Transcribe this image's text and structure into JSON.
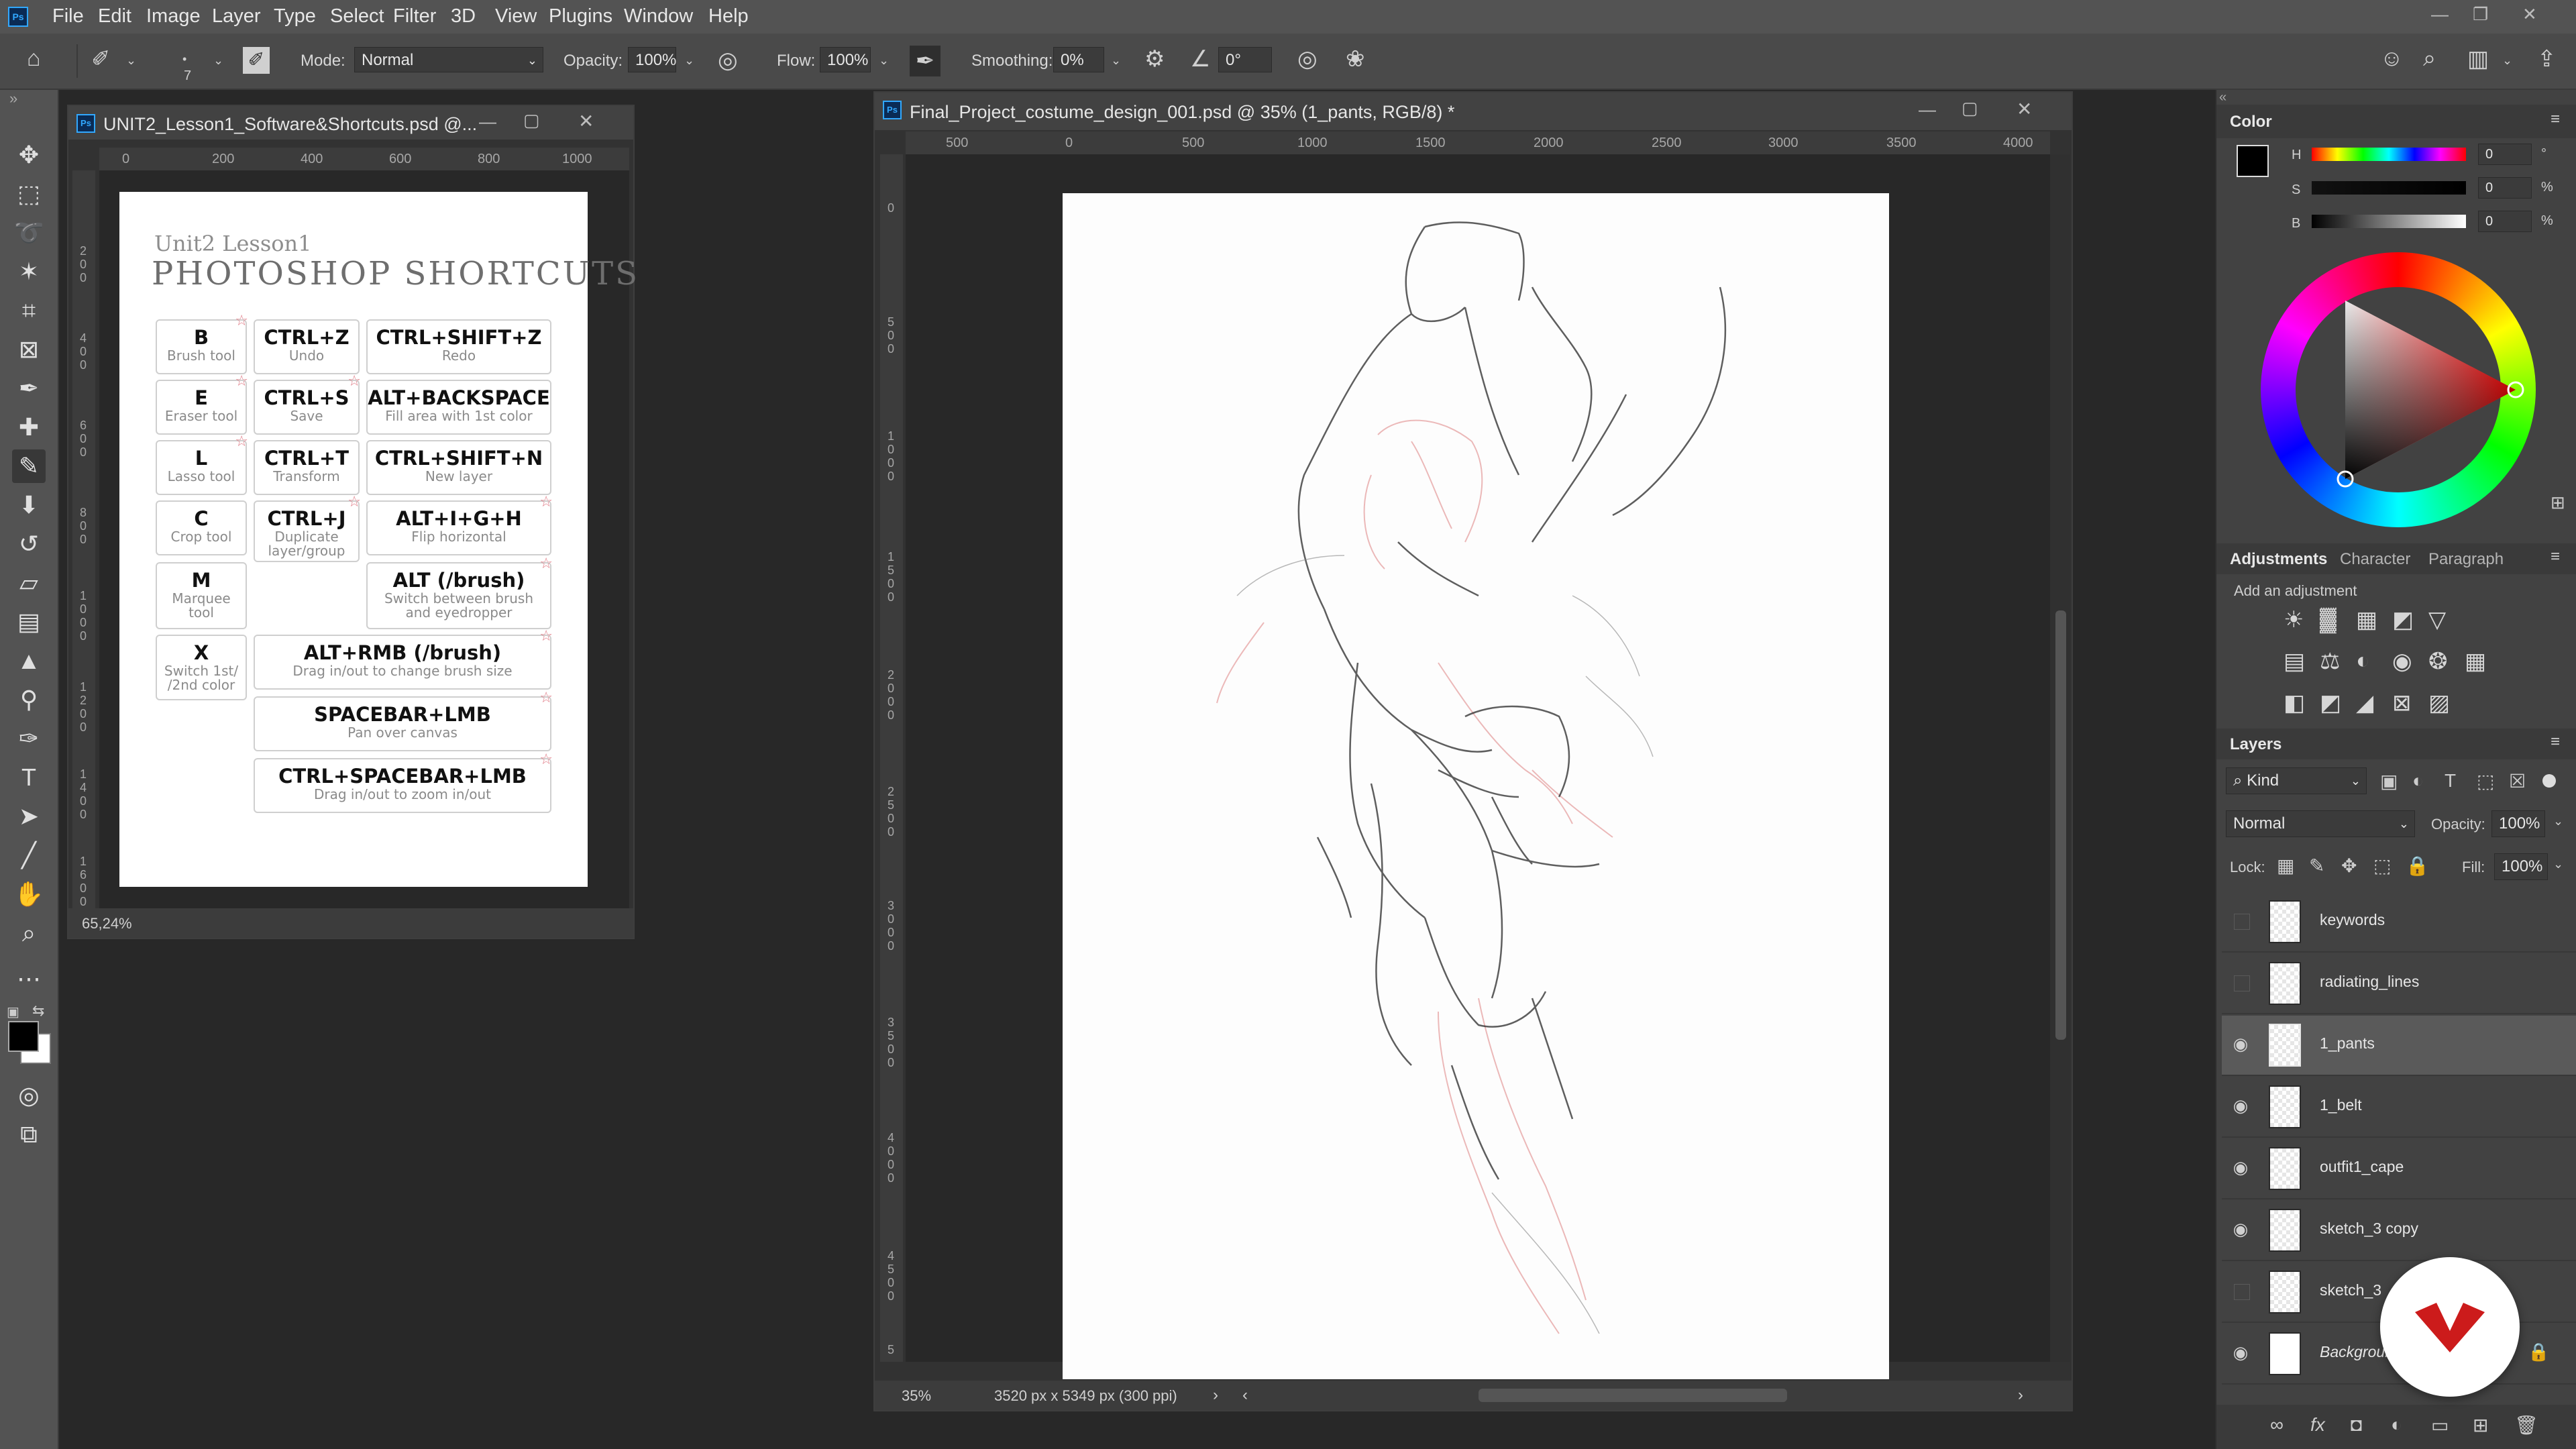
{
  "colors": {
    "accent": "#31a8ff",
    "red_key": "#d42a3a",
    "brand_red": "#cc1b1b"
  },
  "app": {
    "logo_text": "Ps"
  },
  "menu": [
    "File",
    "Edit",
    "Image",
    "Layer",
    "Type",
    "Select",
    "Filter",
    "3D",
    "View",
    "Plugins",
    "Window",
    "Help"
  ],
  "options": {
    "brush_size": "7",
    "mode_label": "Mode:",
    "mode_value": "Normal",
    "opacity_label": "Opacity:",
    "opacity_value": "100%",
    "flow_label": "Flow:",
    "flow_value": "100%",
    "smoothing_label": "Smoothing:",
    "smoothing_value": "0%",
    "angle_value": "0°"
  },
  "doc1": {
    "title": "UNIT2_Lesson1_Software&Shortcuts.psd @...",
    "zoom": "65,24%",
    "ruler_h": [
      "0",
      "200",
      "400",
      "600",
      "800",
      "1000"
    ],
    "ruler_v": [
      "2\n0\n0",
      "4\n0\n0",
      "6\n0\n0",
      "8\n0\n0",
      "1\n0\n0\n0",
      "1\n2\n0\n0",
      "1\n4\n0\n0",
      "1\n6\n0\n0"
    ],
    "heading_small": "Unit2 Lesson1",
    "heading_big": "PHOTOSHOP SHORTCUTS",
    "shortcuts": {
      "b": {
        "key": "B",
        "desc": "Brush tool"
      },
      "ctrl_z": {
        "key": "CTRL+Z",
        "desc": "Undo"
      },
      "ctrl_shift_z": {
        "key": "CTRL+SHIFT+Z",
        "desc": "Redo"
      },
      "e": {
        "key": "E",
        "desc": "Eraser tool"
      },
      "ctrl_s": {
        "key": "CTRL+S",
        "desc": "Save"
      },
      "alt_backspace": {
        "key": "ALT+BACKSPACE",
        "desc": "Fill area with 1st color"
      },
      "l": {
        "key": "L",
        "desc": "Lasso tool"
      },
      "ctrl_t": {
        "key": "CTRL+T",
        "desc": "Transform"
      },
      "ctrl_shift_n": {
        "key": "CTRL+SHIFT+N",
        "desc": "New layer"
      },
      "c": {
        "key": "C",
        "desc": "Crop tool"
      },
      "ctrl_j": {
        "key": "CTRL+J",
        "desc1": "Duplicate",
        "desc2": "layer/group"
      },
      "alt_i_g_h": {
        "key": "ALT+I+G+H",
        "desc": "Flip horizontal"
      },
      "m": {
        "key": "M",
        "desc1": "Marquee",
        "desc2": "tool"
      },
      "alt_brush": {
        "key": "ALT (/brush)",
        "desc1": "Switch between brush",
        "desc2": "and eyedropper"
      },
      "x": {
        "key": "X",
        "desc1": "Switch 1st/",
        "desc2": "/2nd color"
      },
      "alt_rmb": {
        "key": "ALT+RMB (/brush)",
        "desc": "Drag in/out to change brush size"
      },
      "space_lmb": {
        "key": "SPACEBAR+LMB",
        "desc": "Pan over canvas"
      },
      "ctrl_space_lmb": {
        "key": "CTRL+SPACEBAR+LMB",
        "desc": "Drag in/out to zoom in/out"
      }
    }
  },
  "doc2": {
    "title": "Final_Project_costume_design_001.psd @ 35% (1_pants, RGB/8) *",
    "zoom": "35%",
    "dimensions": "3520 px x 5349 px (300 ppi)",
    "ruler_h": [
      "500",
      "0",
      "500",
      "1000",
      "1500",
      "2000",
      "2500",
      "3000",
      "3500",
      "4000"
    ],
    "ruler_v": [
      "0",
      "5\n0\n0",
      "1\n0\n0\n0",
      "1\n5\n0\n0",
      "2\n0\n0\n0",
      "2\n5\n0\n0",
      "3\n0\n0\n0",
      "3\n5\n0\n0",
      "4\n0\n0\n0",
      "4\n5\n0\n0",
      "5"
    ]
  },
  "color_panel": {
    "title": "Color",
    "h_label": "H",
    "s_label": "S",
    "b_label": "B",
    "h_value": "0",
    "s_value": "0",
    "b_value": "0",
    "h_unit": "°",
    "s_unit": "%",
    "b_unit": "%"
  },
  "adjustments": {
    "tabs": [
      "Adjustments",
      "Character",
      "Paragraph"
    ],
    "add_label": "Add an adjustment"
  },
  "layers_panel": {
    "title": "Layers",
    "kind": "Kind",
    "blend_mode": "Normal",
    "opacity_label": "Opacity:",
    "opacity_value": "100%",
    "lock_label": "Lock:",
    "fill_label": "Fill:",
    "fill_value": "100%",
    "layers": [
      {
        "name": "keywords",
        "visible": false
      },
      {
        "name": "radiating_lines",
        "visible": false
      },
      {
        "name": "1_pants",
        "visible": true,
        "selected": true
      },
      {
        "name": "1_belt",
        "visible": true
      },
      {
        "name": "outfit1_cape",
        "visible": true
      },
      {
        "name": "sketch_3 copy",
        "visible": true
      },
      {
        "name": "sketch_3",
        "visible": false
      },
      {
        "name": "Background",
        "visible": true
      }
    ]
  }
}
